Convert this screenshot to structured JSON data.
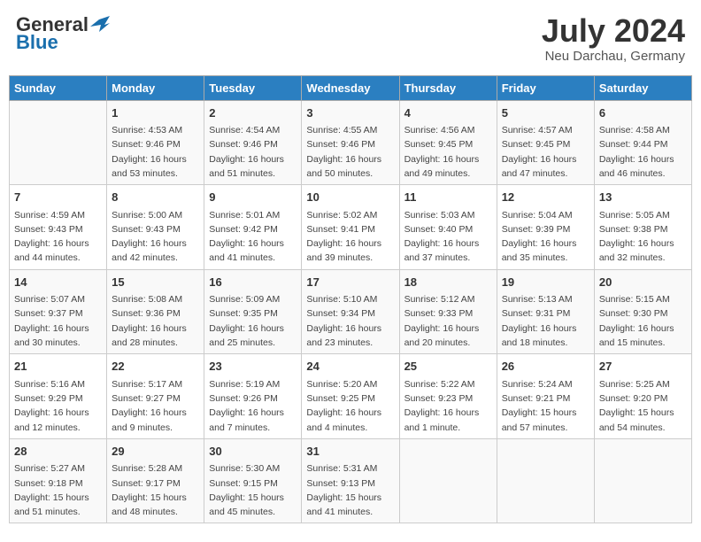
{
  "header": {
    "logo_general": "General",
    "logo_blue": "Blue",
    "month_title": "July 2024",
    "location": "Neu Darchau, Germany"
  },
  "days_of_week": [
    "Sunday",
    "Monday",
    "Tuesday",
    "Wednesday",
    "Thursday",
    "Friday",
    "Saturday"
  ],
  "weeks": [
    [
      {
        "day": "",
        "info": ""
      },
      {
        "day": "1",
        "info": "Sunrise: 4:53 AM\nSunset: 9:46 PM\nDaylight: 16 hours\nand 53 minutes."
      },
      {
        "day": "2",
        "info": "Sunrise: 4:54 AM\nSunset: 9:46 PM\nDaylight: 16 hours\nand 51 minutes."
      },
      {
        "day": "3",
        "info": "Sunrise: 4:55 AM\nSunset: 9:46 PM\nDaylight: 16 hours\nand 50 minutes."
      },
      {
        "day": "4",
        "info": "Sunrise: 4:56 AM\nSunset: 9:45 PM\nDaylight: 16 hours\nand 49 minutes."
      },
      {
        "day": "5",
        "info": "Sunrise: 4:57 AM\nSunset: 9:45 PM\nDaylight: 16 hours\nand 47 minutes."
      },
      {
        "day": "6",
        "info": "Sunrise: 4:58 AM\nSunset: 9:44 PM\nDaylight: 16 hours\nand 46 minutes."
      }
    ],
    [
      {
        "day": "7",
        "info": "Sunrise: 4:59 AM\nSunset: 9:43 PM\nDaylight: 16 hours\nand 44 minutes."
      },
      {
        "day": "8",
        "info": "Sunrise: 5:00 AM\nSunset: 9:43 PM\nDaylight: 16 hours\nand 42 minutes."
      },
      {
        "day": "9",
        "info": "Sunrise: 5:01 AM\nSunset: 9:42 PM\nDaylight: 16 hours\nand 41 minutes."
      },
      {
        "day": "10",
        "info": "Sunrise: 5:02 AM\nSunset: 9:41 PM\nDaylight: 16 hours\nand 39 minutes."
      },
      {
        "day": "11",
        "info": "Sunrise: 5:03 AM\nSunset: 9:40 PM\nDaylight: 16 hours\nand 37 minutes."
      },
      {
        "day": "12",
        "info": "Sunrise: 5:04 AM\nSunset: 9:39 PM\nDaylight: 16 hours\nand 35 minutes."
      },
      {
        "day": "13",
        "info": "Sunrise: 5:05 AM\nSunset: 9:38 PM\nDaylight: 16 hours\nand 32 minutes."
      }
    ],
    [
      {
        "day": "14",
        "info": "Sunrise: 5:07 AM\nSunset: 9:37 PM\nDaylight: 16 hours\nand 30 minutes."
      },
      {
        "day": "15",
        "info": "Sunrise: 5:08 AM\nSunset: 9:36 PM\nDaylight: 16 hours\nand 28 minutes."
      },
      {
        "day": "16",
        "info": "Sunrise: 5:09 AM\nSunset: 9:35 PM\nDaylight: 16 hours\nand 25 minutes."
      },
      {
        "day": "17",
        "info": "Sunrise: 5:10 AM\nSunset: 9:34 PM\nDaylight: 16 hours\nand 23 minutes."
      },
      {
        "day": "18",
        "info": "Sunrise: 5:12 AM\nSunset: 9:33 PM\nDaylight: 16 hours\nand 20 minutes."
      },
      {
        "day": "19",
        "info": "Sunrise: 5:13 AM\nSunset: 9:31 PM\nDaylight: 16 hours\nand 18 minutes."
      },
      {
        "day": "20",
        "info": "Sunrise: 5:15 AM\nSunset: 9:30 PM\nDaylight: 16 hours\nand 15 minutes."
      }
    ],
    [
      {
        "day": "21",
        "info": "Sunrise: 5:16 AM\nSunset: 9:29 PM\nDaylight: 16 hours\nand 12 minutes."
      },
      {
        "day": "22",
        "info": "Sunrise: 5:17 AM\nSunset: 9:27 PM\nDaylight: 16 hours\nand 9 minutes."
      },
      {
        "day": "23",
        "info": "Sunrise: 5:19 AM\nSunset: 9:26 PM\nDaylight: 16 hours\nand 7 minutes."
      },
      {
        "day": "24",
        "info": "Sunrise: 5:20 AM\nSunset: 9:25 PM\nDaylight: 16 hours\nand 4 minutes."
      },
      {
        "day": "25",
        "info": "Sunrise: 5:22 AM\nSunset: 9:23 PM\nDaylight: 16 hours\nand 1 minute."
      },
      {
        "day": "26",
        "info": "Sunrise: 5:24 AM\nSunset: 9:21 PM\nDaylight: 15 hours\nand 57 minutes."
      },
      {
        "day": "27",
        "info": "Sunrise: 5:25 AM\nSunset: 9:20 PM\nDaylight: 15 hours\nand 54 minutes."
      }
    ],
    [
      {
        "day": "28",
        "info": "Sunrise: 5:27 AM\nSunset: 9:18 PM\nDaylight: 15 hours\nand 51 minutes."
      },
      {
        "day": "29",
        "info": "Sunrise: 5:28 AM\nSunset: 9:17 PM\nDaylight: 15 hours\nand 48 minutes."
      },
      {
        "day": "30",
        "info": "Sunrise: 5:30 AM\nSunset: 9:15 PM\nDaylight: 15 hours\nand 45 minutes."
      },
      {
        "day": "31",
        "info": "Sunrise: 5:31 AM\nSunset: 9:13 PM\nDaylight: 15 hours\nand 41 minutes."
      },
      {
        "day": "",
        "info": ""
      },
      {
        "day": "",
        "info": ""
      },
      {
        "day": "",
        "info": ""
      }
    ]
  ]
}
